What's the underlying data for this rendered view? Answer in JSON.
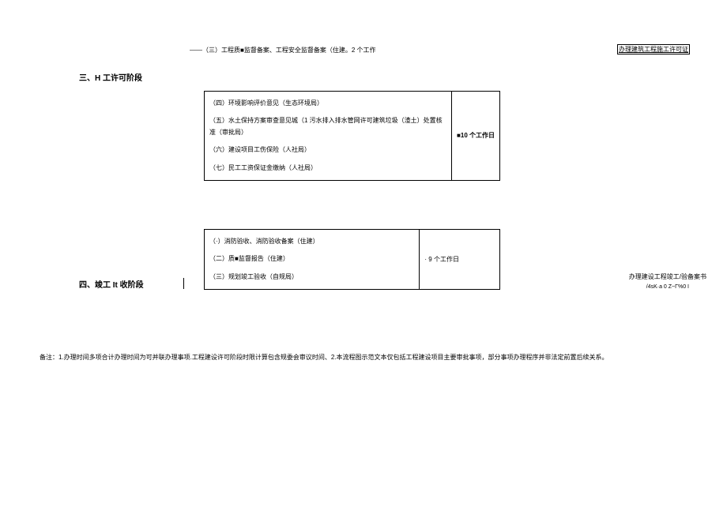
{
  "top": {
    "text": "——（三）工程质■监督备案、工程安全监督备案（住建。2 个工作"
  },
  "rightLink1": "办理建筑工程施工许可证",
  "stage3": {
    "label": "三、H 工许可阶段",
    "items": [
      "（四）环境影响评价意见（生态环境局）",
      "（五）水土保持方案审查意见城（1 污水排入排水管网许可建筑垃圾（渣土）处置核准（审批局）",
      "（六）建设项目工伤保险（人社局）",
      "（七）民工工资保证金缴纳（人社局）"
    ],
    "days": "■10 个工作日"
  },
  "stage4": {
    "label": "四、竣工 It 收阶段",
    "items": [
      "（·）消防验收、消防验收备案（住建）",
      "（二）质■监督报告（住建）",
      "（三）规划竣工验收（自规局）"
    ],
    "days": "· 9 个工作日"
  },
  "rightLink2": {
    "main": "办理建设工程竣工/验备案书",
    "sub": "/4sK·a 0 Z~Γ%0 I"
  },
  "footer": "备注：1.办理时间多项合计办理时间为可并联办理事项.工程建设许可阶段时限计算包含规委会审议时间、2.本流程图示范文本仅包括工程建设项目主要审批事项，部分事项办理程序并非法定前置后续关系。"
}
